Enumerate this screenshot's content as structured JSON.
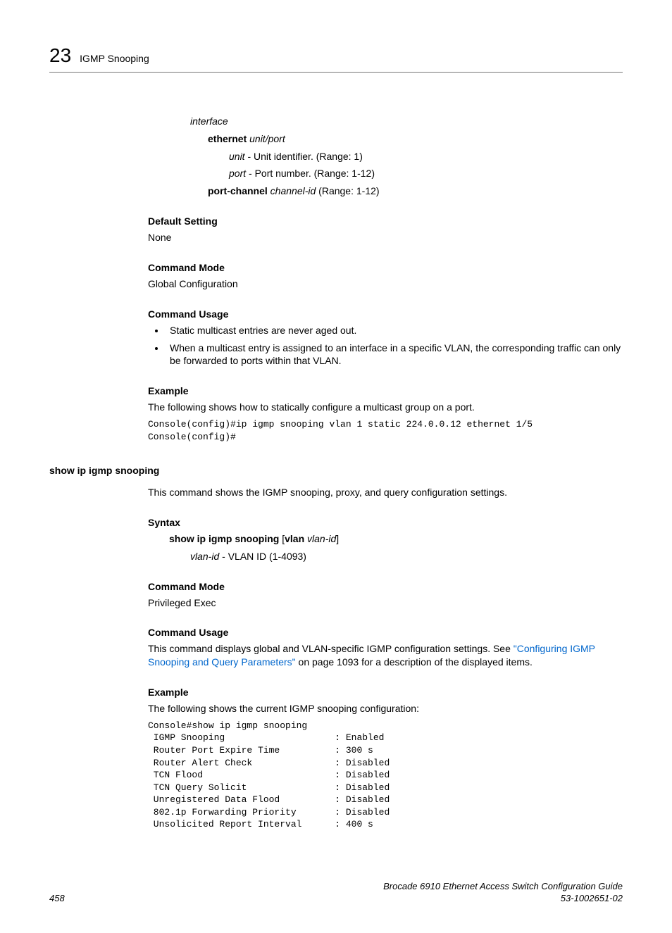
{
  "header": {
    "chapter_num": "23",
    "chapter_title": "IGMP Snooping"
  },
  "s1": {
    "interface": "interface",
    "ethernet": "ethernet",
    "unit_port": "unit/port",
    "unit_lbl": "unit",
    "unit_desc": " - Unit identifier. (Range: 1)",
    "port_lbl": "port",
    "port_desc": " - Port number. (Range: 1-12)",
    "pc": "port-channel",
    "pc_arg": "channel-id",
    "pc_range": " (Range: 1-12)"
  },
  "defset": {
    "head": "Default Setting",
    "body": "None"
  },
  "cmode1": {
    "head": "Command Mode",
    "body": "Global Configuration"
  },
  "cusage1": {
    "head": "Command Usage",
    "b1": "Static multicast entries are never aged out.",
    "b2": "When a multicast entry is assigned to an interface in a specific VLAN, the corresponding traffic can only be forwarded to ports within that VLAN."
  },
  "ex1": {
    "head": "Example",
    "body": "The following shows how to statically configure a multicast group on a port.",
    "code": "Console(config)#ip igmp snooping vlan 1 static 224.0.0.12 ethernet 1/5\nConsole(config)#"
  },
  "cmd2": {
    "title": "show ip igmp snooping",
    "intro": "This command shows the IGMP snooping, proxy, and query configuration settings."
  },
  "syntax2": {
    "head": "Syntax",
    "cmd": "show ip igmp snooping",
    "opt_kw": "vlan",
    "opt_arg": "vlan-id",
    "arg_lbl": "vlan-id",
    "arg_desc": " - VLAN ID (1-4093)"
  },
  "cmode2": {
    "head": "Command Mode",
    "body": "Privileged Exec"
  },
  "cusage2": {
    "head": "Command Usage",
    "pre": "This command displays global and VLAN-specific IGMP configuration settings. See ",
    "link": "\"Configuring IGMP Snooping and Query Parameters\"",
    "post": " on page 1093 for a description of the displayed items."
  },
  "ex2": {
    "head": "Example",
    "body": "The following shows the current IGMP snooping configuration:",
    "code": "Console#show ip igmp snooping\n IGMP Snooping                    : Enabled\n Router Port Expire Time          : 300 s\n Router Alert Check               : Disabled\n TCN Flood                        : Disabled\n TCN Query Solicit                : Disabled\n Unregistered Data Flood          : Disabled\n 802.1p Forwarding Priority       : Disabled\n Unsolicited Report Interval      : 400 s"
  },
  "footer": {
    "page": "458",
    "doc1": "Brocade 6910 Ethernet Access Switch Configuration Guide",
    "doc2": "53-1002651-02"
  }
}
